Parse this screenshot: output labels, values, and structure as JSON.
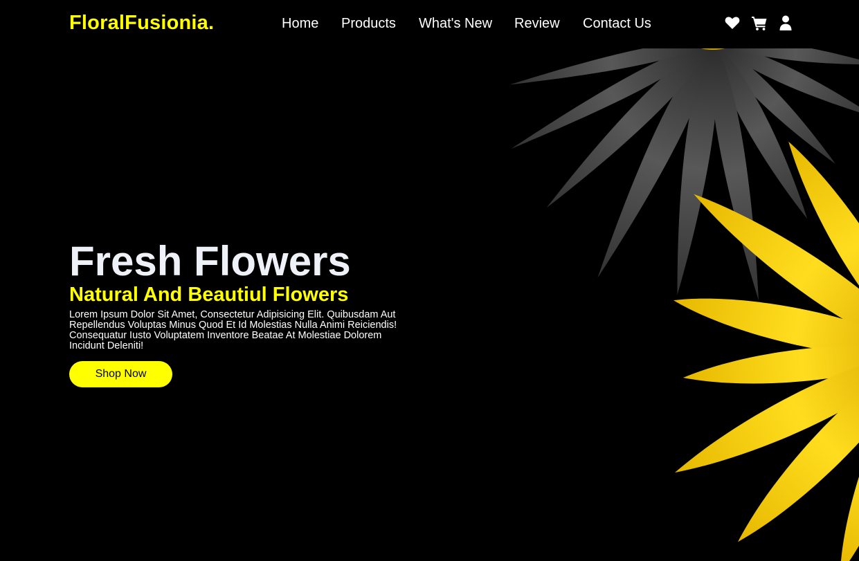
{
  "header": {
    "logo": "FloralFusionia.",
    "nav": [
      {
        "label": "Home"
      },
      {
        "label": "Products"
      },
      {
        "label": "What's New"
      },
      {
        "label": "Review"
      },
      {
        "label": "Contact Us"
      }
    ],
    "icons": [
      "heart-icon",
      "cart-icon",
      "user-icon"
    ]
  },
  "hero": {
    "title": "Fresh Flowers",
    "subtitle": "Natural And Beautiul Flowers",
    "body": "Lorem Ipsum Dolor Sit Amet, Consectetur Adipisicing Elit. Quibusdam Aut Repellendus Voluptas Minus Quod Et Id Molestias Nulla Animi Reiciendis! Consequatur Iusto Voluptatem Inventore Beatae At Molestiae Dolorem Incidunt Deleniti!",
    "cta": "Shop Now"
  },
  "colors": {
    "background": "#000000",
    "accent": "#ffff00",
    "text": "#ffffff"
  }
}
